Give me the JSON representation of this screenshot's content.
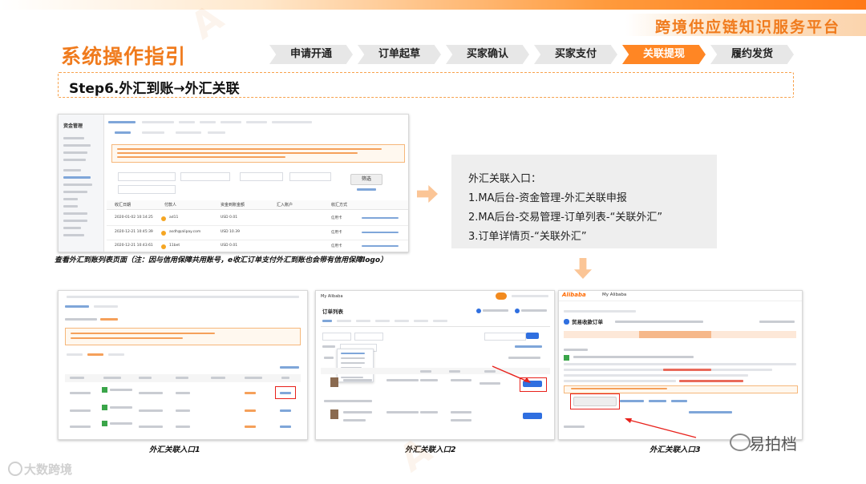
{
  "brand": {
    "title": "跨境供应链知识服务平台"
  },
  "page": {
    "title": "系统操作指引",
    "step_title": "Step6.外汇到账→外汇关联"
  },
  "steps": [
    {
      "label": "申请开通",
      "active": false
    },
    {
      "label": "订单起草",
      "active": false
    },
    {
      "label": "买家确认",
      "active": false
    },
    {
      "label": "买家支付",
      "active": false
    },
    {
      "label": "关联提现",
      "active": true
    },
    {
      "label": "履约发货",
      "active": false
    }
  ],
  "screenshot_main": {
    "sidebar_title": "资金管理",
    "search_button": "筛选",
    "columns": [
      "收汇日期",
      "付款人",
      "资金到账金额",
      "汇入账户",
      "收汇方式"
    ],
    "rows": [
      {
        "date": "2020-01-02 10:14:25",
        "payer": "ad11",
        "amount": "USD 0.01",
        "method": "信用卡"
      },
      {
        "date": "2020-12-21 10:45:39",
        "payer": "asdh@alipay.com",
        "amount": "USD 10.39",
        "method": "信用卡"
      },
      {
        "date": "2020-12-21 10:43:61",
        "payer": "11bet",
        "amount": "USD 0.01",
        "method": "信用卡"
      }
    ],
    "caption": "查看外汇到账列表页面（注：因与信用保障共用账号，e收汇订单支付外汇到账也会带有信用保障logo）"
  },
  "info_box": {
    "title": "外汇关联入口：",
    "lines": [
      "1.MA后台-资金管理-外汇关联申报",
      "2.MA后台-交易管理-订单列表-“关联外汇”",
      "3.订单详情页-“关联外汇”"
    ]
  },
  "captions": {
    "entry1": "外汇关联入口1",
    "entry2": "外汇关联入口2",
    "entry3": "外汇关联入口3"
  },
  "screenshot_entry2": {
    "title": "订单列表",
    "header": "My Alibaba"
  },
  "screenshot_entry3": {
    "logo": "Alibaba",
    "header": "My Alibaba",
    "order_title": "贸易收款订单"
  },
  "footer": {
    "wechat": "易拍档",
    "logo": "大数跨境"
  },
  "colors": {
    "accent": "#f07b1d",
    "active_step": "#ff8624",
    "highlight": "#e8211b"
  }
}
